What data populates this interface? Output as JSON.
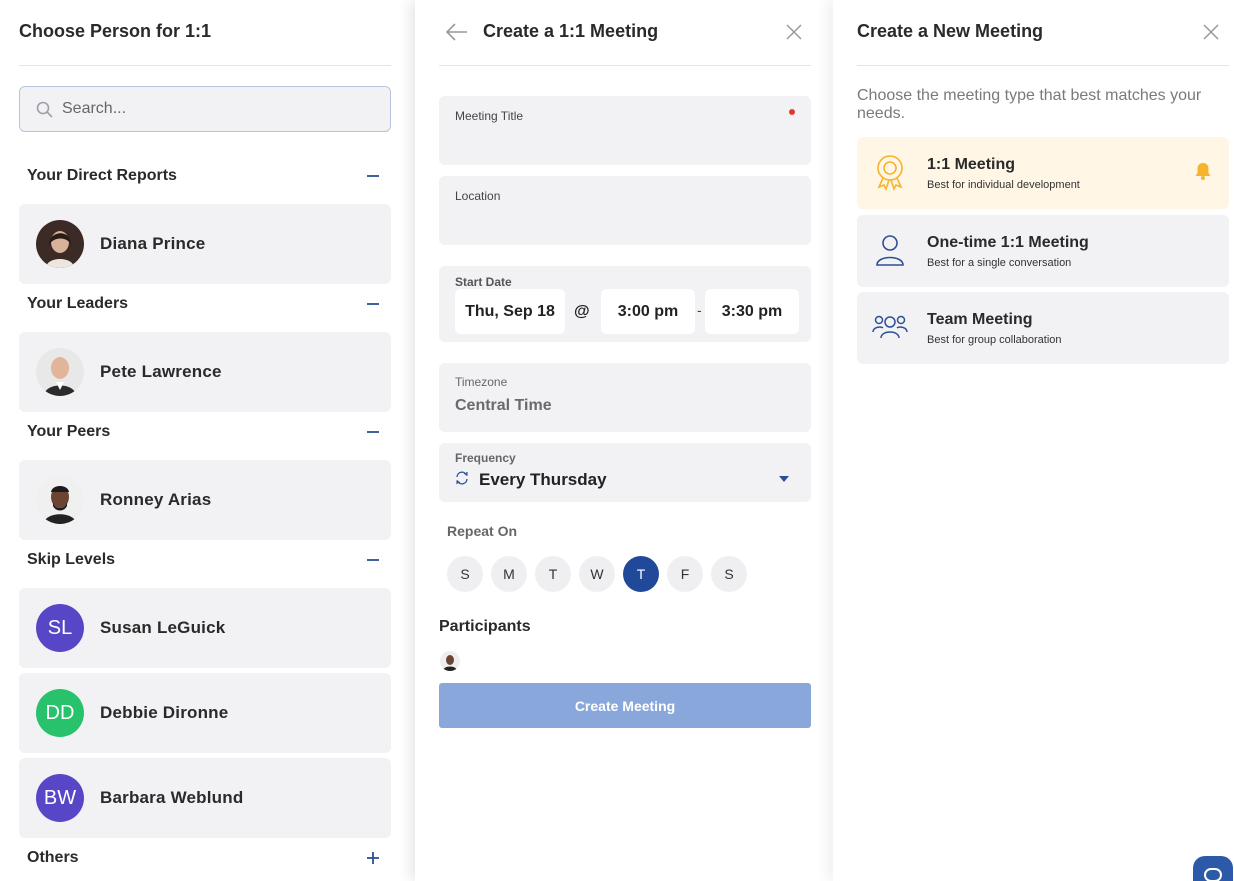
{
  "left": {
    "title": "Choose Person for 1:1",
    "search_placeholder": "Search...",
    "sections": [
      {
        "label": "Your Direct Reports",
        "toggle": "collapse",
        "people": [
          {
            "name": "Diana Prince",
            "avatar": "photo"
          }
        ]
      },
      {
        "label": "Your Leaders",
        "toggle": "collapse",
        "people": [
          {
            "name": "Pete Lawrence",
            "avatar": "photo"
          }
        ]
      },
      {
        "label": "Your Peers",
        "toggle": "collapse",
        "people": [
          {
            "name": "Ronney Arias",
            "avatar": "photo"
          }
        ]
      },
      {
        "label": "Skip Levels",
        "toggle": "collapse",
        "people": [
          {
            "name": "Susan LeGuick",
            "initials": "SL",
            "color": "#5747c7"
          },
          {
            "name": "Debbie Dironne",
            "initials": "DD",
            "color": "#27c26b"
          },
          {
            "name": "Barbara Weblund",
            "initials": "BW",
            "color": "#5747c7"
          }
        ]
      },
      {
        "label": "Others",
        "toggle": "expand",
        "people": []
      }
    ]
  },
  "middle": {
    "title": "Create a 1:1 Meeting",
    "meeting_title_label": "Meeting Title",
    "location_label": "Location",
    "start_date_label": "Start Date",
    "date": "Thu, Sep 18",
    "at": "@",
    "start_time": "3:00 pm",
    "dash": "-",
    "end_time": "3:30 pm",
    "timezone_label": "Timezone",
    "timezone": "Central Time",
    "frequency_label": "Frequency",
    "frequency": "Every Thursday",
    "repeat_on_label": "Repeat On",
    "days": [
      "S",
      "M",
      "T",
      "W",
      "T",
      "F",
      "S"
    ],
    "selected_day_index": 4,
    "participants_label": "Participants",
    "create_button": "Create Meeting"
  },
  "right": {
    "title": "Create a New Meeting",
    "subtitle": "Choose the meeting type that best matches your needs.",
    "types": [
      {
        "name": "1:1 Meeting",
        "desc": "Best for individual development",
        "icon": "award-ribbon-icon",
        "selected": true
      },
      {
        "name": "One-time 1:1 Meeting",
        "desc": "Best for a single conversation",
        "icon": "user-icon",
        "selected": false
      },
      {
        "name": "Team Meeting",
        "desc": "Best for group collaboration",
        "icon": "users-icon",
        "selected": false
      }
    ]
  },
  "colors": {
    "accent": "#20499a",
    "button_disabled": "#8aa7dc",
    "selected_card": "#fff6e5",
    "bell": "#f6b42c",
    "required": "#e53935"
  }
}
